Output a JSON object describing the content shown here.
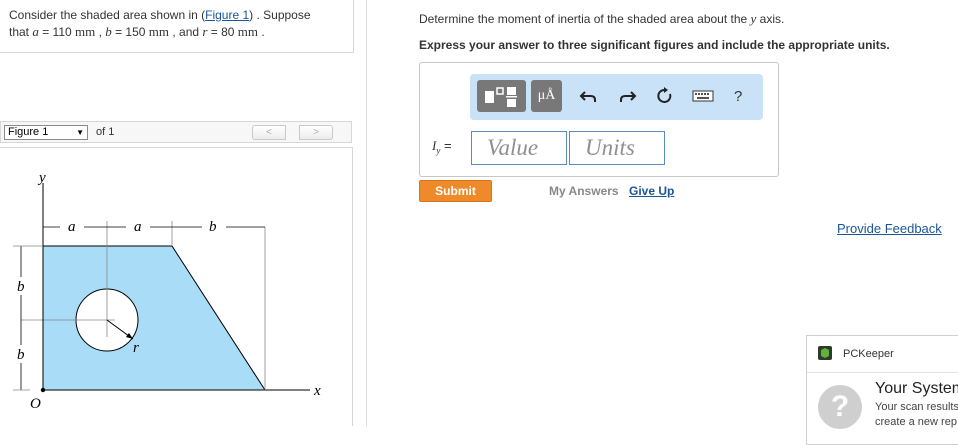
{
  "problem": {
    "line1_prefix": "Consider the shaded area shown in (",
    "line1_link": "Figure 1",
    "line1_suffix": ") . Suppose",
    "line2": {
      "t1": "that ",
      "a_sym": "a",
      "t2": " = 110 ",
      "unit1": "mm",
      "t3": " , ",
      "b_sym": "b",
      "t4": " = 150 ",
      "unit2": "mm",
      "t5": " , and ",
      "r_sym": "r",
      "t6": " = 80 ",
      "unit3": "mm",
      "t7": " ."
    }
  },
  "figure_nav": {
    "select_value": "Figure 1",
    "of_text": "of 1",
    "prev": "<",
    "next": ">"
  },
  "figure": {
    "labels": {
      "y": "y",
      "x": "x",
      "o": "O",
      "a1": "a",
      "a2": "a",
      "b_top": "b",
      "b_left1": "b",
      "b_left2": "b",
      "r": "r"
    },
    "colors": {
      "fill": "#a9dcf6",
      "stroke": "#000000"
    }
  },
  "question": {
    "line1_prefix": "Determine the moment of inertia of the shaded area about the ",
    "line1_sym": "y",
    "line1_suffix": " axis.",
    "line2": "Express your answer to three significant figures and include the appropriate units."
  },
  "toolbar": {
    "micro_label": "μÅ",
    "icons": [
      "template-icon",
      "micro-angstrom-icon",
      "undo-icon",
      "redo-icon",
      "reset-icon",
      "keyboard-icon",
      "help-icon"
    ],
    "help": "?"
  },
  "answer": {
    "label_sym": "I",
    "label_sub": "y",
    "label_eq": " =",
    "value_placeholder": "Value",
    "units_placeholder": "Units"
  },
  "actions": {
    "submit": "Submit",
    "my_answers": "My Answers",
    "give_up": "Give Up",
    "provide_feedback": "Provide Feedback"
  },
  "popup": {
    "title": "PCKeeper",
    "heading": "Your System",
    "line1": "Your scan results",
    "line2": "create a new rep",
    "icon": "?"
  },
  "colors": {
    "link": "#1a5599",
    "submit_bg": "#ee8a2a",
    "toolbar_bg": "#c9e2f7",
    "input_border": "#5b8bc4"
  }
}
